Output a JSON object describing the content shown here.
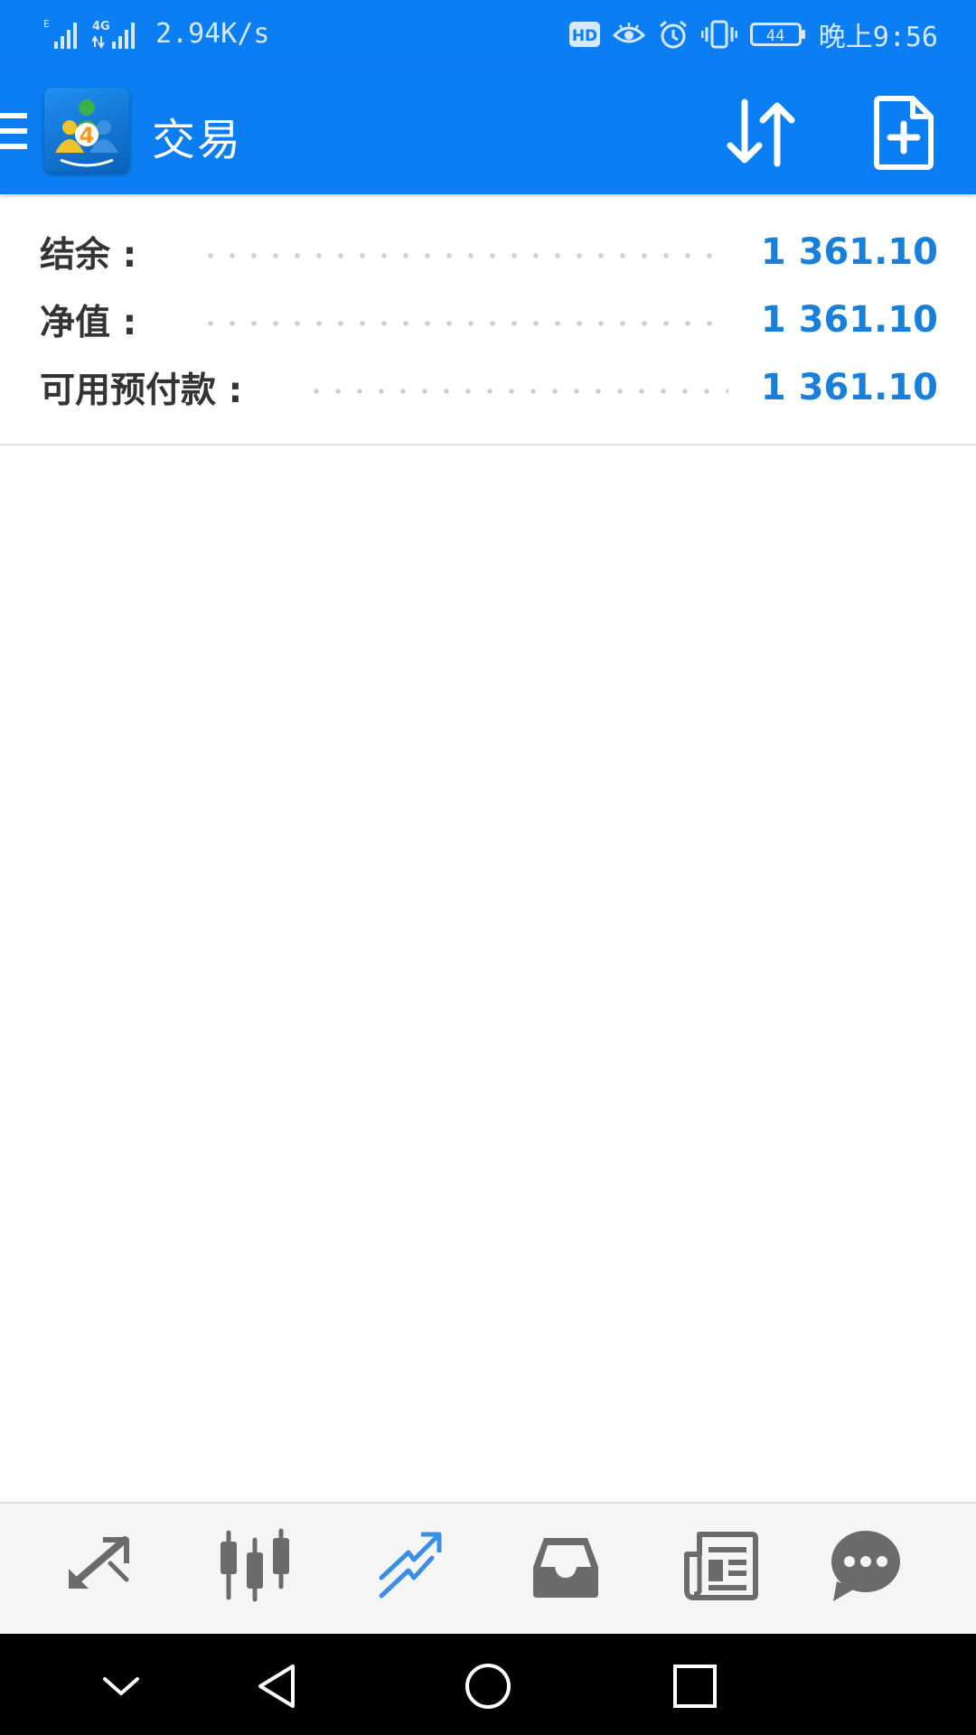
{
  "status_bar": {
    "network_speed": "2.94K/s",
    "network_1": "E",
    "network_2": "4G",
    "hd_badge": "HD",
    "battery_level": "44",
    "time": "晚上9:56",
    "icons": [
      "signal-icon",
      "signal-4g-icon",
      "hd-icon",
      "eye-icon",
      "alarm-icon",
      "vibrate-icon",
      "battery-icon"
    ]
  },
  "app_bar": {
    "title": "交易",
    "logo_number": "4",
    "icons": [
      "menu-icon",
      "sort-icon",
      "new-order-icon"
    ]
  },
  "account_summary": [
    {
      "label": "结余 :",
      "value": "1 361.10"
    },
    {
      "label": "净值 :",
      "value": "1 361.10"
    },
    {
      "label": "可用预付款 :",
      "value": "1 361.10"
    }
  ],
  "bottom_nav": {
    "active_index": 2,
    "items": [
      "quotes-icon",
      "charts-icon",
      "trade-icon",
      "history-icon",
      "news-icon",
      "messages-icon"
    ]
  },
  "system_nav": [
    "collapse-icon",
    "back-icon",
    "home-icon",
    "recents-icon"
  ],
  "colors": {
    "primary": "#0a7ef2",
    "value_blue": "#1a7fd8",
    "label_gray": "#333333",
    "nav_active": "#3a8ee6",
    "nav_inactive": "#6b6b6b"
  }
}
